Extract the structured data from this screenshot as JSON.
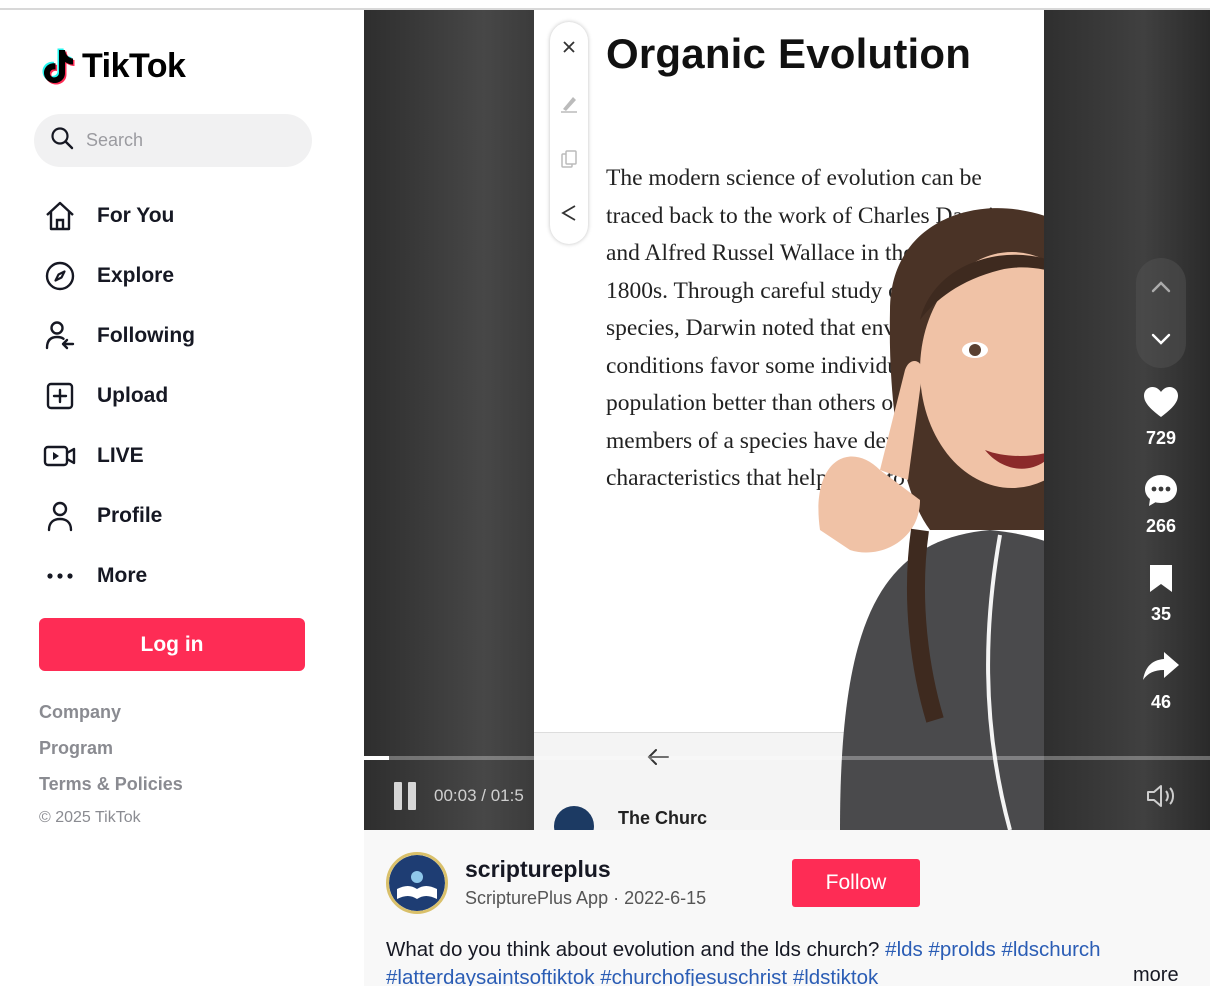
{
  "brand": {
    "name": "TikTok"
  },
  "search": {
    "placeholder": "Search"
  },
  "nav": [
    {
      "label": "For You",
      "icon": "home-icon"
    },
    {
      "label": "Explore",
      "icon": "compass-icon"
    },
    {
      "label": "Following",
      "icon": "following-icon"
    },
    {
      "label": "Upload",
      "icon": "upload-icon"
    },
    {
      "label": "LIVE",
      "icon": "live-icon"
    },
    {
      "label": "Profile",
      "icon": "profile-icon"
    },
    {
      "label": "More",
      "icon": "more-icon"
    }
  ],
  "login": {
    "label": "Log in"
  },
  "footer": {
    "company": "Company",
    "program": "Program",
    "terms": "Terms & Policies",
    "copyright": "© 2025 TikTok"
  },
  "video": {
    "doc_title": "Organic Evolution",
    "doc_text": "The modern science of evolution can be traced back to the work of Charles Darwin and Alfred Russel Wallace in the mid-1800s. Through careful study of animal species, Darwin noted that environmental conditions favor some individuals in a population better than others over time, members of a species have developed characteristics that help them to",
    "church_name": "The Churc",
    "time": "00:03 / 01:5",
    "progress_fraction": 0.03
  },
  "stats": {
    "likes": "729",
    "comments": "266",
    "saves": "35",
    "shares": "46"
  },
  "post": {
    "username": "scriptureplus",
    "subline": "ScripturePlus App · 2022-6-15",
    "follow_label": "Follow",
    "caption_text": "What do you think about evolution and the lds church? ",
    "hashtags": [
      "#lds",
      "#prolds",
      "#ldschurch",
      "#latterdaysaintsoftiktok",
      "#churchofjesuschrist",
      "#ldstiktok"
    ],
    "more_label": "more"
  },
  "colors": {
    "accent": "#fe2c55",
    "hashtag": "#2b5db5"
  }
}
